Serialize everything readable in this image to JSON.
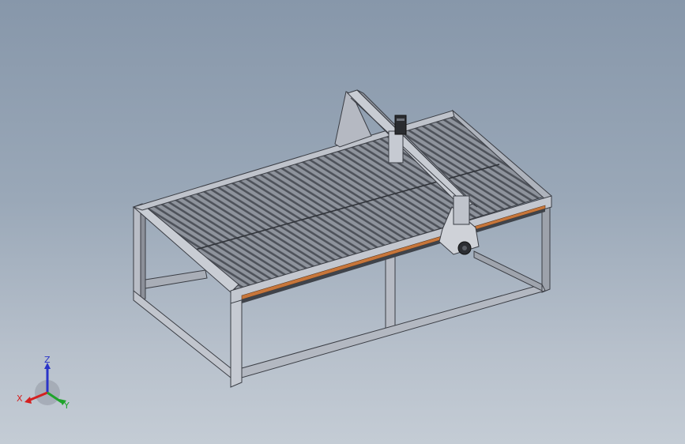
{
  "viewport": {
    "background_top": "#8797aa",
    "background_bottom": "#c4ccd5"
  },
  "model": {
    "frame_color": "#b4b9c4",
    "frame_edge": "#3a3d44",
    "slat_color": "#5b5f66",
    "rail_accent": "#c8763a"
  },
  "triad": {
    "x_label": "X",
    "y_label": "Y",
    "z_label": "Z",
    "x_color": "#d42020",
    "y_color": "#1fa32b",
    "z_color": "#2a34c8"
  }
}
